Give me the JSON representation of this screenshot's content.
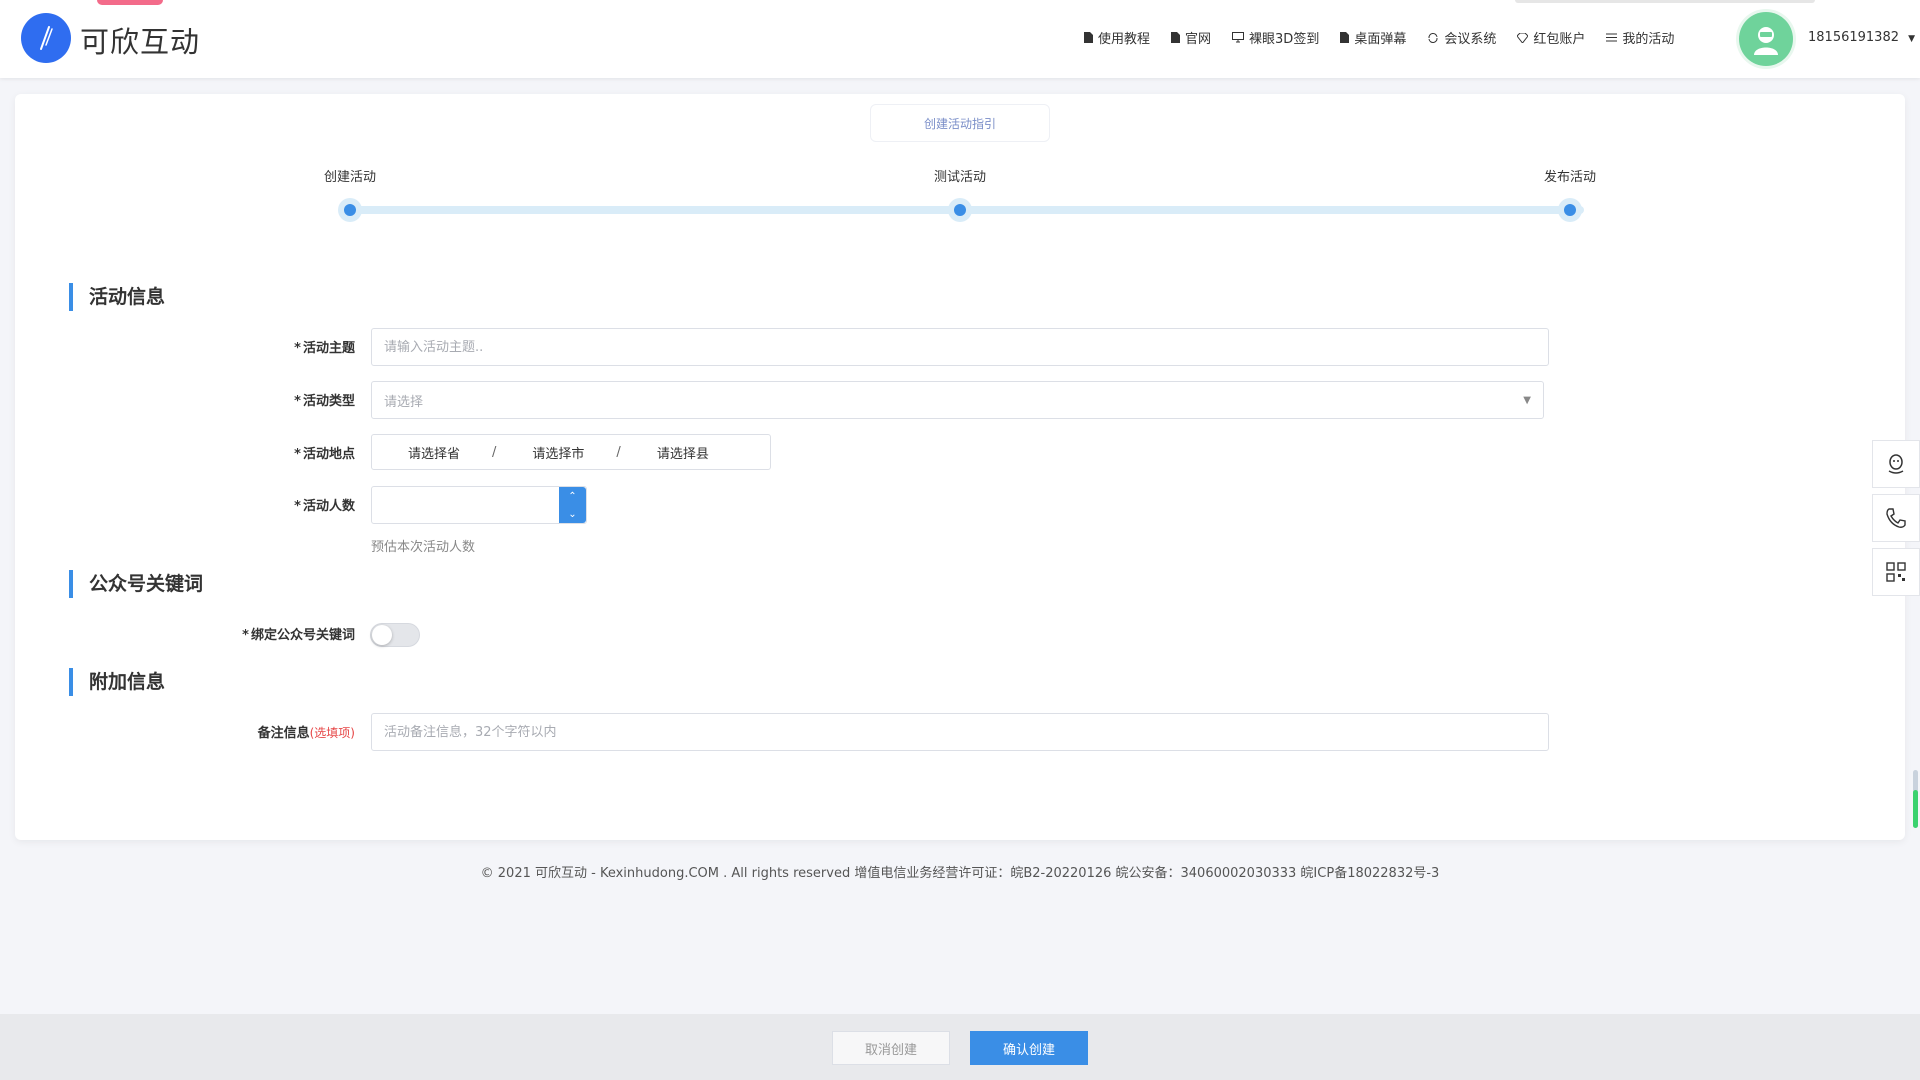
{
  "header": {
    "brand_name": "可欣互动",
    "nav": [
      {
        "label": "使用教程",
        "icon": "doc-icon"
      },
      {
        "label": "官网",
        "icon": "doc-icon"
      },
      {
        "label": "裸眼3D签到",
        "icon": "monitor-icon"
      },
      {
        "label": "桌面弹幕",
        "icon": "doc-icon"
      },
      {
        "label": "会议系统",
        "icon": "sync-icon"
      },
      {
        "label": "红包账户",
        "icon": "gem-icon"
      },
      {
        "label": "我的活动",
        "icon": "list-icon"
      }
    ],
    "user_phone": "18156191382"
  },
  "guide_button": "创建活动指引",
  "steps": [
    "创建活动",
    "测试活动",
    "发布活动"
  ],
  "sections": {
    "activity_info": "活动信息",
    "wechat_keyword": "公众号关键词",
    "extra_info": "附加信息"
  },
  "form": {
    "subject_label": "活动主题",
    "subject_placeholder": "请输入活动主题..",
    "type_label": "活动类型",
    "type_placeholder": "请选择",
    "location_label": "活动地点",
    "location_province": "请选择省",
    "location_city": "请选择市",
    "location_county": "请选择县",
    "location_separator": "/",
    "people_label": "活动人数",
    "people_hint": "预估本次活动人数",
    "keyword_label": "绑定公众号关键词",
    "keyword_enabled": false,
    "remark_label": "备注信息",
    "remark_optional": "(选填项)",
    "remark_placeholder": "活动备注信息，32个字符以内",
    "required_mark": "*"
  },
  "footer": {
    "copyright": "© 2021 可欣互动 - Kexinhudong.COM . All rights reserved 增值电信业务经营许可证：皖B2-20220126 皖公安备：34060002030333 皖ICP备18022832号-3"
  },
  "actions": {
    "cancel": "取消创建",
    "confirm": "确认创建"
  },
  "colors": {
    "accent": "#3a8ee6",
    "logo": "#2f6df0",
    "avatar": "#6fd39b",
    "optional_text": "#e64545"
  }
}
